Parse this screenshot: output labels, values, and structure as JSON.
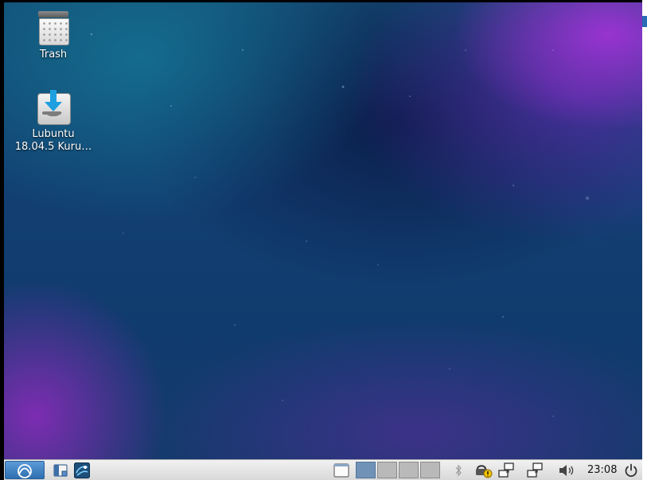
{
  "desktop": {
    "icons": [
      {
        "label": "Trash",
        "icon": "trash-icon"
      },
      {
        "label": "Lubuntu\n18.04.5 Kuru…",
        "label_line1": "Lubuntu",
        "label_line2": "18.04.5 Kuru…",
        "icon": "installer-icon"
      }
    ]
  },
  "panel": {
    "menu_icon": "lubuntu-logo-icon",
    "launchers": [
      "file-manager-icon",
      "browser-icon"
    ],
    "tray_icons": [
      "show-desktop-icon",
      "bluetooth-icon",
      "network-updates-icon",
      "network-icon",
      "network-icon",
      "volume-icon",
      "power-icon"
    ],
    "pager": {
      "desktops": 4,
      "active": 1
    },
    "clock": "23:08"
  },
  "colors": {
    "panel_bg": "#e6e6e6",
    "pager_active": "#7092b7",
    "pager_inactive": "#b9b9b9",
    "menu_button": "#3f83c6"
  }
}
